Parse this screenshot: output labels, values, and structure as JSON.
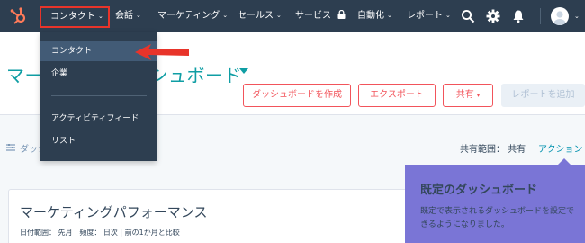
{
  "nav": {
    "contacts": "コンタクト",
    "conversations": "会話",
    "marketing": "マーケティング",
    "sales": "セールス",
    "service": "サービス",
    "automation": "自動化",
    "reports": "レポート"
  },
  "dropdown": {
    "items": [
      "コンタクト",
      "企業",
      "アクティビティフィード",
      "リスト"
    ]
  },
  "page": {
    "title": "マーケティングダッシュボード",
    "title_visible_left": "マーケ",
    "title_visible_right": "シュボード"
  },
  "toolbar": {
    "create": "ダッシュボードを作成",
    "export": "エクスポート",
    "share": "共有",
    "add_report": "レポートを追加"
  },
  "filter": {
    "label": "ダッシ",
    "share_range": "共有範囲：",
    "share_value": "共有",
    "actions": "アクション"
  },
  "card": {
    "title": "マーケティングパフォーマンス",
    "meta": "日付範囲：  先月   |   頻度：  日次   |   前の1か月と比較"
  },
  "tooltip": {
    "title": "既定のダッシュボード",
    "body": "既定で表示されるダッシュボードを設定できるようになりました。"
  },
  "colors": {
    "nav_bg": "#2d3e50",
    "accent_teal": "#0f9ea4",
    "accent_coral": "#f2545b",
    "highlight_red": "#e8342a",
    "tooltip_bg": "#7a75d6"
  },
  "icons": [
    "hubspot-logo-icon",
    "search-icon",
    "gear-icon",
    "bell-icon",
    "avatar-icon",
    "lock-icon",
    "filter-icon"
  ]
}
